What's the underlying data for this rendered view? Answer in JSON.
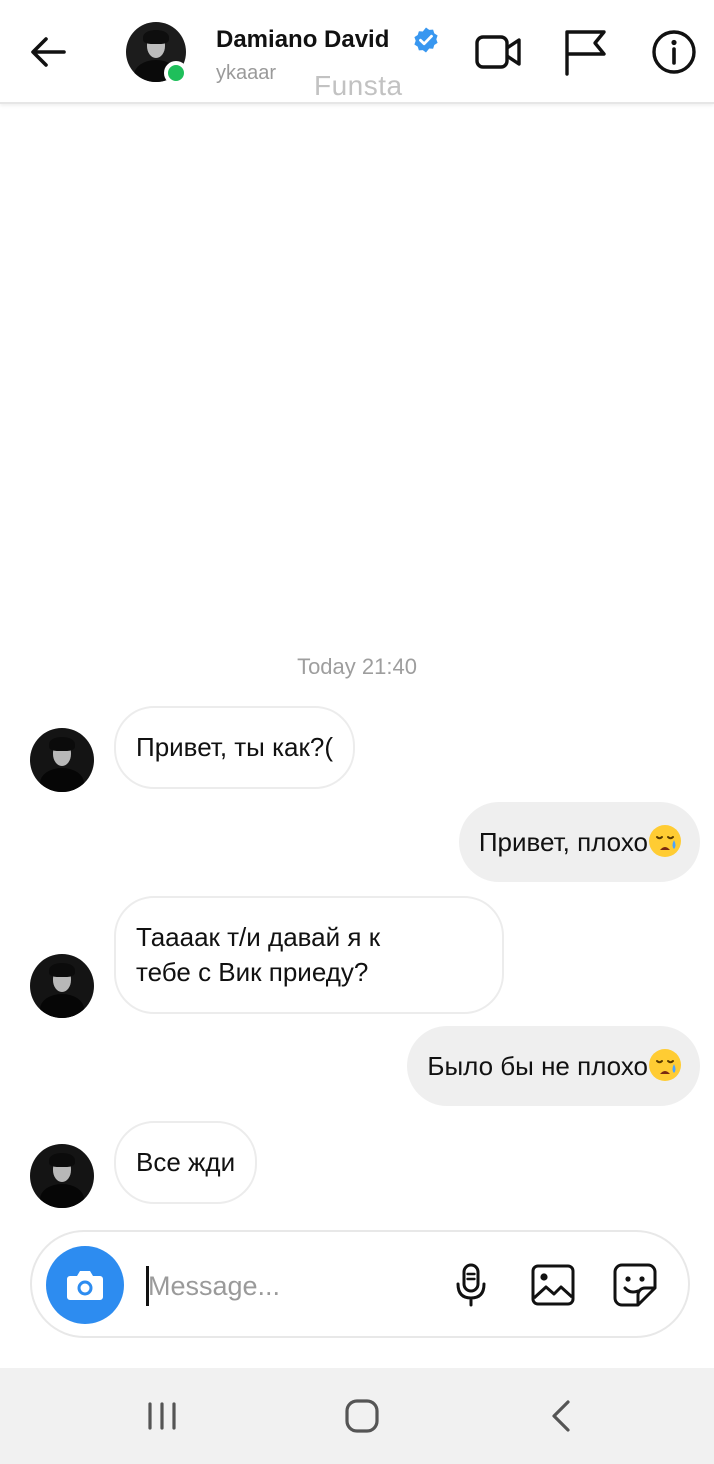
{
  "header": {
    "name": "Damiano David",
    "username": "ykaaar",
    "watermark": "Funsta",
    "verified": true,
    "online": true,
    "online_color": "#1fbf5b",
    "verified_color": "#3897f0"
  },
  "chat": {
    "timestamp": "Today 21:40",
    "messages": [
      {
        "direction": "incoming",
        "text": "Привет, ты как?("
      },
      {
        "direction": "outgoing",
        "text": "Привет, плохо",
        "emoji": "sad-tear-emoji"
      },
      {
        "direction": "incoming",
        "line1": "Тааaак т/и давай я к",
        "line2": "тебе с Вик приеду?"
      },
      {
        "direction": "outgoing",
        "text": "Было бы не плохо",
        "emoji": "sad-tear-emoji"
      },
      {
        "direction": "incoming",
        "text": "Все жди"
      }
    ]
  },
  "composer": {
    "placeholder": "Message...",
    "value": "",
    "camera_color": "#2d8cf0"
  },
  "icons": {
    "back": "arrow-left-icon",
    "video": "video-camera-icon",
    "flag": "flag-icon",
    "info": "info-icon",
    "camera": "camera-icon",
    "mic": "microphone-icon",
    "gallery": "image-icon",
    "sticker": "sticker-icon"
  }
}
